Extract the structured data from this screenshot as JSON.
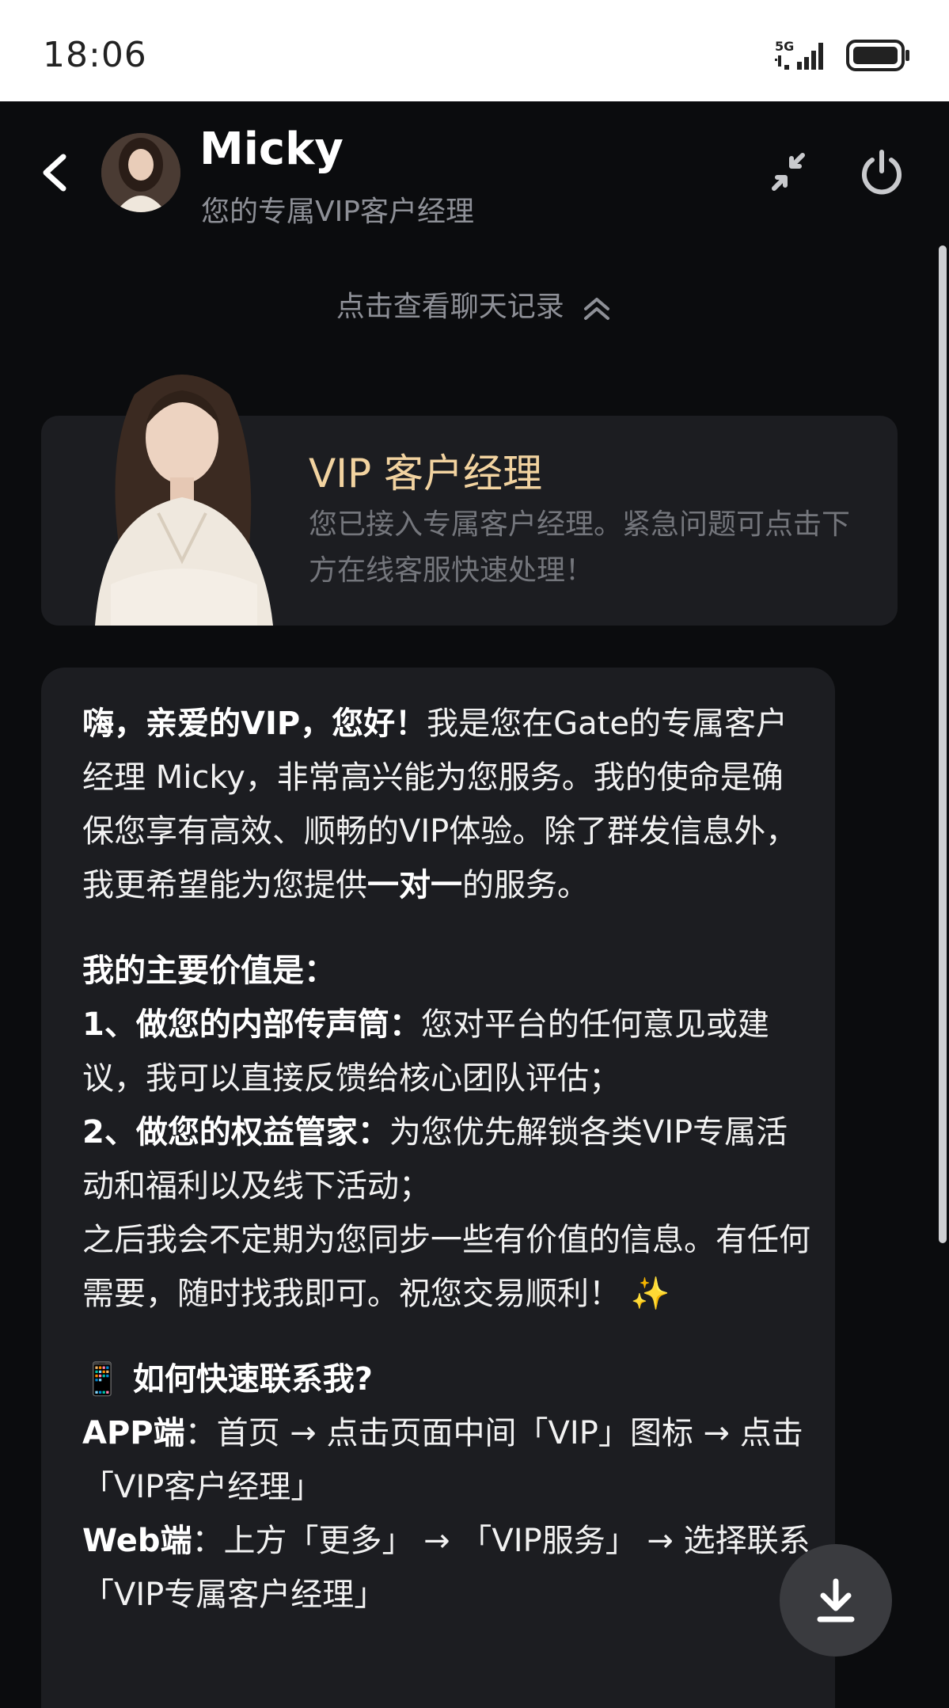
{
  "status_bar": {
    "time": "18:06",
    "network": "5G"
  },
  "header": {
    "title": "Micky",
    "subtitle": "您的专属VIP客户经理"
  },
  "history_link": "点击查看聊天记录",
  "vip_card": {
    "title": "VIP 客户经理",
    "desc": "您已接入专属客户经理。紧急问题可点击下方在线客服快速处理！"
  },
  "message": {
    "p1_bold": "嗨，亲爱的VIP，您好！",
    "p1_text": "我是您在Gate的专属客户经理 Micky，非常高兴能为您服务。我的使命是确保您享有高效、顺畅的VIP体验。除了群发信息外，我更希望能为您提供",
    "p1_bold2": "一对一",
    "p1_tail": "的服务。",
    "values_heading": "我的主要价值是：",
    "item1_bold": "1、做您的内部传声筒：",
    "item1_text": "您对平台的任何意见或建议，我可以直接反馈给核心团队评估；",
    "item2_bold": "2、做您的权益管家：",
    "item2_text": "为您优先解锁各类VIP专属活动和福利以及线下活动；",
    "closing": "之后我会不定期为您同步一些有价值的信息。有任何需要，随时找我即可。祝您交易顺利！ ✨",
    "contact_heading": "📱 如何快速联系我?",
    "app_label": "APP端",
    "app_text": "：首页 → 点击页面中间「VIP」图标 → 点击「VIP客户经理」",
    "web_label": "Web端",
    "web_text": "：上方「更多」 → 「VIP服务」 → 选择联系「VIP专属客户经理」"
  },
  "colors": {
    "accent_gold": "#f2d3a0",
    "card_bg": "#1c1d21",
    "page_bg": "#0b0c0e"
  },
  "icons": {
    "back": "chevron-left-icon",
    "minimize": "collapse-arrows-icon",
    "power": "power-icon",
    "download": "download-icon"
  }
}
